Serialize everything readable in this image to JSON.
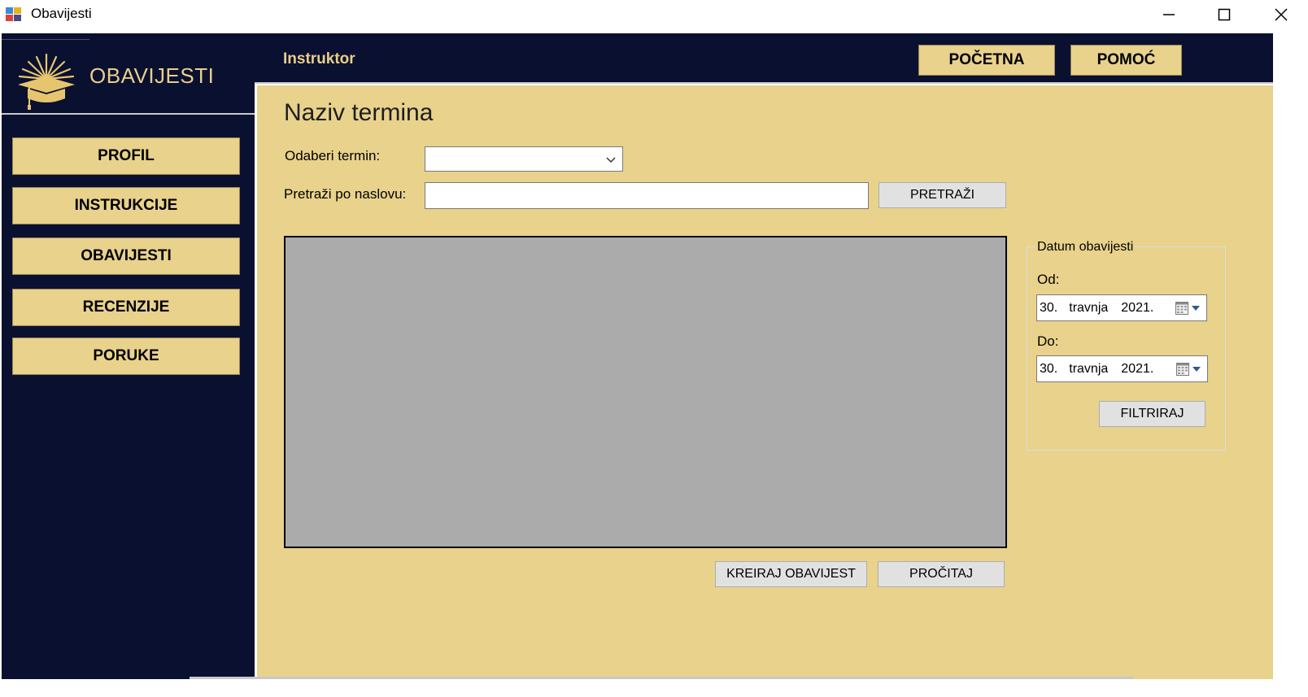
{
  "window": {
    "title": "Obavijesti"
  },
  "sidebar": {
    "logo_text": "OBAVIJESTI",
    "items": [
      {
        "label": "PROFIL"
      },
      {
        "label": "INSTRUKCIJE"
      },
      {
        "label": "OBAVIJESTI"
      },
      {
        "label": "RECENZIJE"
      },
      {
        "label": "PORUKE"
      }
    ]
  },
  "header": {
    "role": "Instruktor",
    "home_label": "POČETNA",
    "help_label": "POMOĆ"
  },
  "main": {
    "title": "Naziv termina",
    "term_label": "Odaberi termin:",
    "term_value": "",
    "search_label": "Pretraži po naslovu:",
    "search_value": "",
    "search_button": "PRETRAŽI",
    "create_button": "KREIRAJ OBAVIJEST",
    "read_button": "PROČITAJ"
  },
  "date_filter": {
    "group_label": "Datum obavijesti",
    "from_label": "Od:",
    "from": {
      "day": "30.",
      "month": "travnja",
      "year": "2021."
    },
    "to_label": "Do:",
    "to": {
      "day": "30.",
      "month": "travnja",
      "year": "2021."
    },
    "filter_button": "FILTRIRAJ"
  },
  "colors": {
    "navy": "#0a1030",
    "gold": "#e8d28c",
    "gold_text": "#e8cf8a",
    "grid_gray": "#ababab"
  }
}
